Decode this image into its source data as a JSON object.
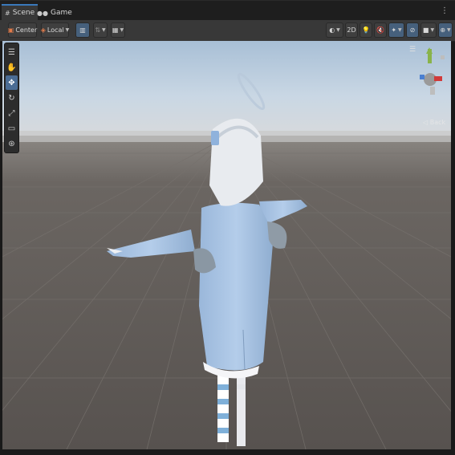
{
  "tabs": [
    {
      "label": "Scene",
      "icon": "hash-icon",
      "active": true
    },
    {
      "label": "Game",
      "icon": "gamepad-icon",
      "active": false
    }
  ],
  "toolbar": {
    "pivot_label": "Center",
    "space_label": "Local",
    "twod_label": "2D"
  },
  "overlay": {
    "view_label": "Back"
  },
  "colors": {
    "accent": "#3a79bb",
    "toolbar_bg": "#383838",
    "tab_bg": "#1e1e1e",
    "sky_top": "#b8c9dd",
    "ground": "#5a5552",
    "hoodie": "#a9c4e4"
  }
}
